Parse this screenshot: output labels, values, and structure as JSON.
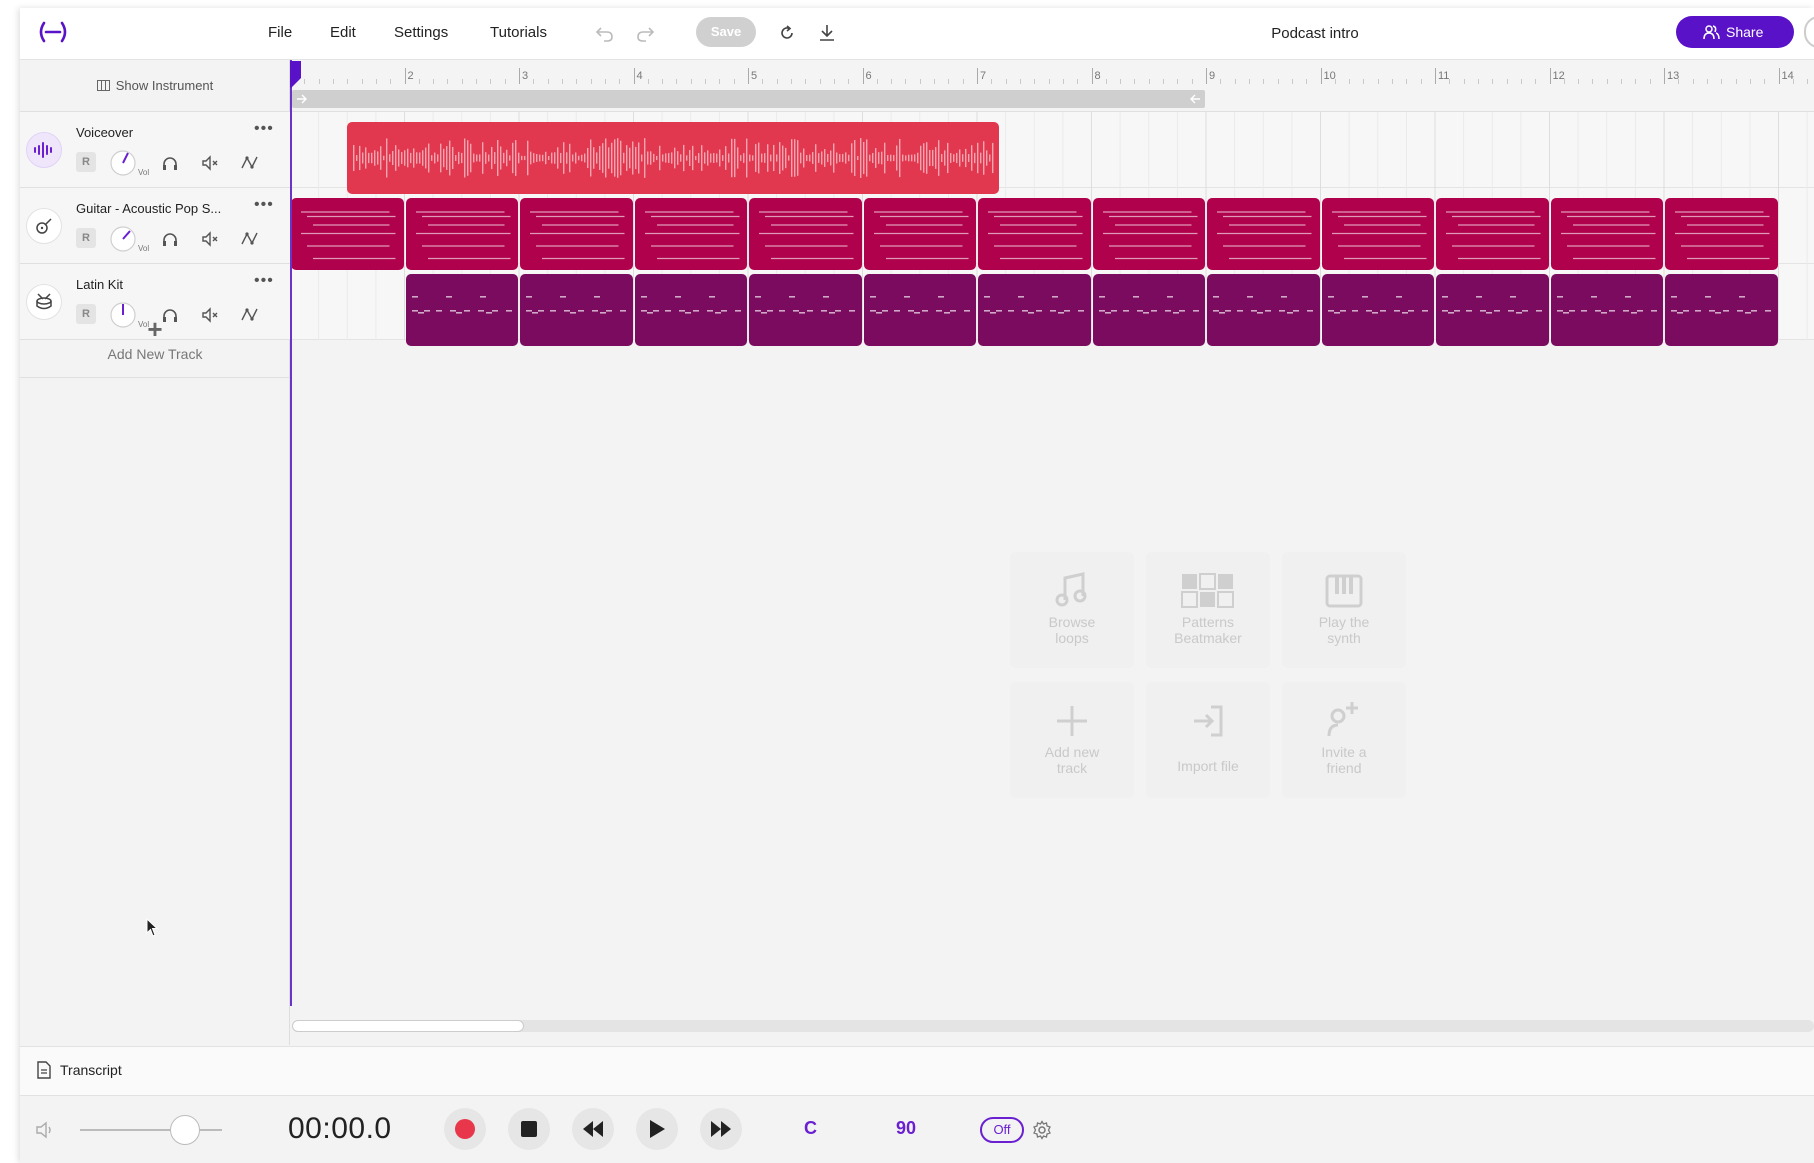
{
  "topbar": {
    "menus": [
      "File",
      "Edit",
      "Settings",
      "Tutorials"
    ],
    "save_label": "Save",
    "project_title": "Podcast intro",
    "share_label": "Share"
  },
  "track_panel": {
    "show_instrument_label": "Show Instrument",
    "tracks": [
      {
        "name": "Voiceover",
        "icon": "waveform-icon",
        "record_label": "R",
        "vol_label": "Vol"
      },
      {
        "name": "Guitar - Acoustic Pop S...",
        "icon": "guitar-icon",
        "record_label": "R",
        "vol_label": "Vol"
      },
      {
        "name": "Latin Kit",
        "icon": "drum-icon",
        "record_label": "R",
        "vol_label": "Vol"
      }
    ],
    "add_track_label": "Add New Track"
  },
  "ruler": {
    "bar_numbers": [
      "2",
      "3",
      "4",
      "5",
      "6",
      "7",
      "8",
      "9",
      "10",
      "11",
      "12",
      "13",
      "14"
    ]
  },
  "clips": {
    "voiceover_color": "#e2384f",
    "guitar_color": "#b0024c",
    "kit_color": "#7a0b5e"
  },
  "empty_state": {
    "actions": [
      {
        "label_line1": "Browse",
        "label_line2": "loops",
        "icon": "music-note-icon"
      },
      {
        "label_line1": "Patterns",
        "label_line2": "Beatmaker",
        "icon": "pattern-grid-icon"
      },
      {
        "label_line1": "Play the",
        "label_line2": "synth",
        "icon": "piano-keys-icon"
      },
      {
        "label_line1": "Add new",
        "label_line2": "track",
        "icon": "plus-icon"
      },
      {
        "label_line1": "Import file",
        "label_line2": "",
        "icon": "import-icon"
      },
      {
        "label_line1": "Invite a",
        "label_line2": "friend",
        "icon": "add-person-icon"
      }
    ]
  },
  "bottom": {
    "transcript_label": "Transcript",
    "time": "00:00.0",
    "key": "C",
    "tempo": "90",
    "metronome": "Off"
  },
  "accent_color": "#5a12c8"
}
